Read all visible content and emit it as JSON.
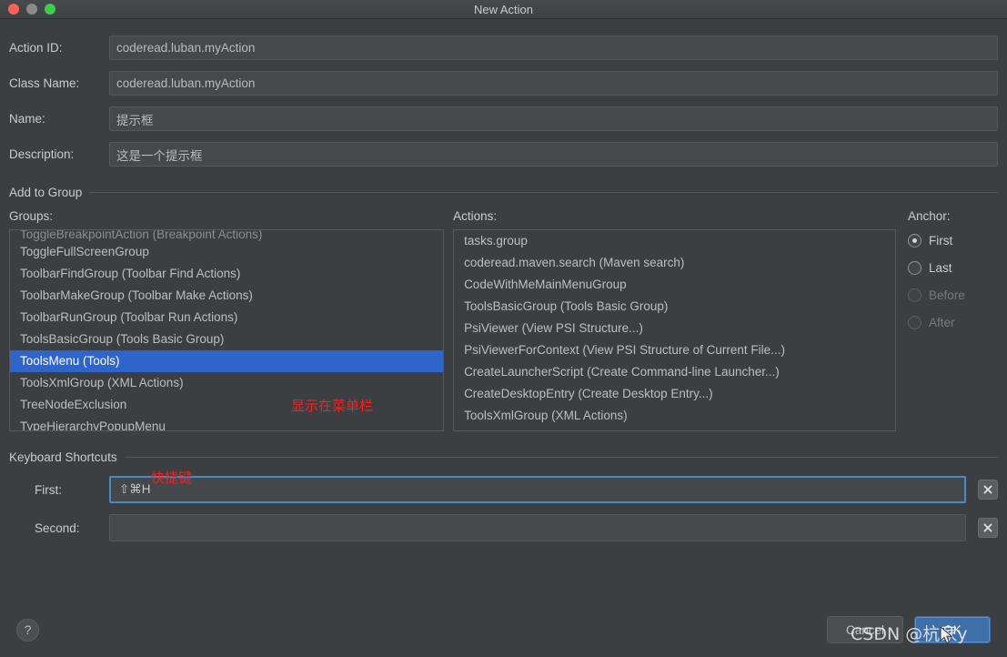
{
  "window": {
    "title": "New Action",
    "traffic_lights": [
      "close-button",
      "minimize-button",
      "zoom-button"
    ]
  },
  "fields": [
    {
      "label": "Action ID:",
      "value": "coderead.luban.myAction",
      "placeholder": ""
    },
    {
      "label": "Class Name:",
      "value": "coderead.luban.myAction",
      "placeholder": ""
    },
    {
      "label": "Name:",
      "value": "提示框",
      "placeholder": ""
    },
    {
      "label": "Description:",
      "value": "这是一个提示框",
      "placeholder": ""
    }
  ],
  "add_to_group": {
    "section_label": "Add to Group",
    "groups": {
      "caption": "Groups:",
      "partial_top_item": "ToggleBreakpointAction (Breakpoint Actions)",
      "items": [
        "ToggleFullScreenGroup",
        "ToolbarFindGroup (Toolbar Find Actions)",
        "ToolbarMakeGroup (Toolbar Make Actions)",
        "ToolbarRunGroup (Toolbar Run Actions)",
        "ToolsBasicGroup (Tools Basic Group)",
        "ToolsMenu (Tools)",
        "ToolsXmlGroup (XML Actions)",
        "TreeNodeExclusion",
        "TypeHierarchyPopupMenu"
      ],
      "selected_index": 5
    },
    "actions": {
      "caption": "Actions:",
      "items": [
        "tasks.group",
        "coderead.maven.search (Maven search)",
        "CodeWithMeMainMenuGroup",
        "ToolsBasicGroup (Tools Basic Group)",
        "PsiViewer (View PSI Structure...)",
        "PsiViewerForContext (View PSI Structure of Current File...)",
        "CreateLauncherScript (Create Command-line Launcher...)",
        "CreateDesktopEntry (Create Desktop Entry...)",
        "ToolsXmlGroup (XML Actions)"
      ],
      "selected_index": -1
    },
    "anchor": {
      "caption": "Anchor:",
      "options": [
        {
          "label": "First",
          "checked": true,
          "disabled": false
        },
        {
          "label": "Last",
          "checked": false,
          "disabled": false
        },
        {
          "label": "Before",
          "checked": false,
          "disabled": true
        },
        {
          "label": "After",
          "checked": false,
          "disabled": true
        }
      ]
    }
  },
  "keyboard_shortcuts": {
    "section_label": "Keyboard Shortcuts",
    "first": {
      "label": "First:",
      "value": "⇧⌘H",
      "placeholder": "",
      "focused": true,
      "clear_label": "clear"
    },
    "second": {
      "label": "Second:",
      "value": "",
      "placeholder": "",
      "focused": false,
      "clear_label": "clear"
    }
  },
  "footer": {
    "help_label": "?",
    "cancel_label": "Cancel",
    "ok_label": "OK"
  },
  "annotations": [
    {
      "id": "annot-menu",
      "text": "显示在菜单栏"
    },
    {
      "id": "annot-short",
      "text": "快捷键"
    }
  ],
  "watermark": {
    "text": "CSDN @杭家y"
  },
  "colors": {
    "window_bg": "#3c3f41",
    "field_bg": "#45494a",
    "border": "#55595b",
    "selection_blue": "#2f65ca",
    "primary_button": "#3f6fa8",
    "annotation_red": "#ff1d1d",
    "text": "#c9cbcc"
  }
}
